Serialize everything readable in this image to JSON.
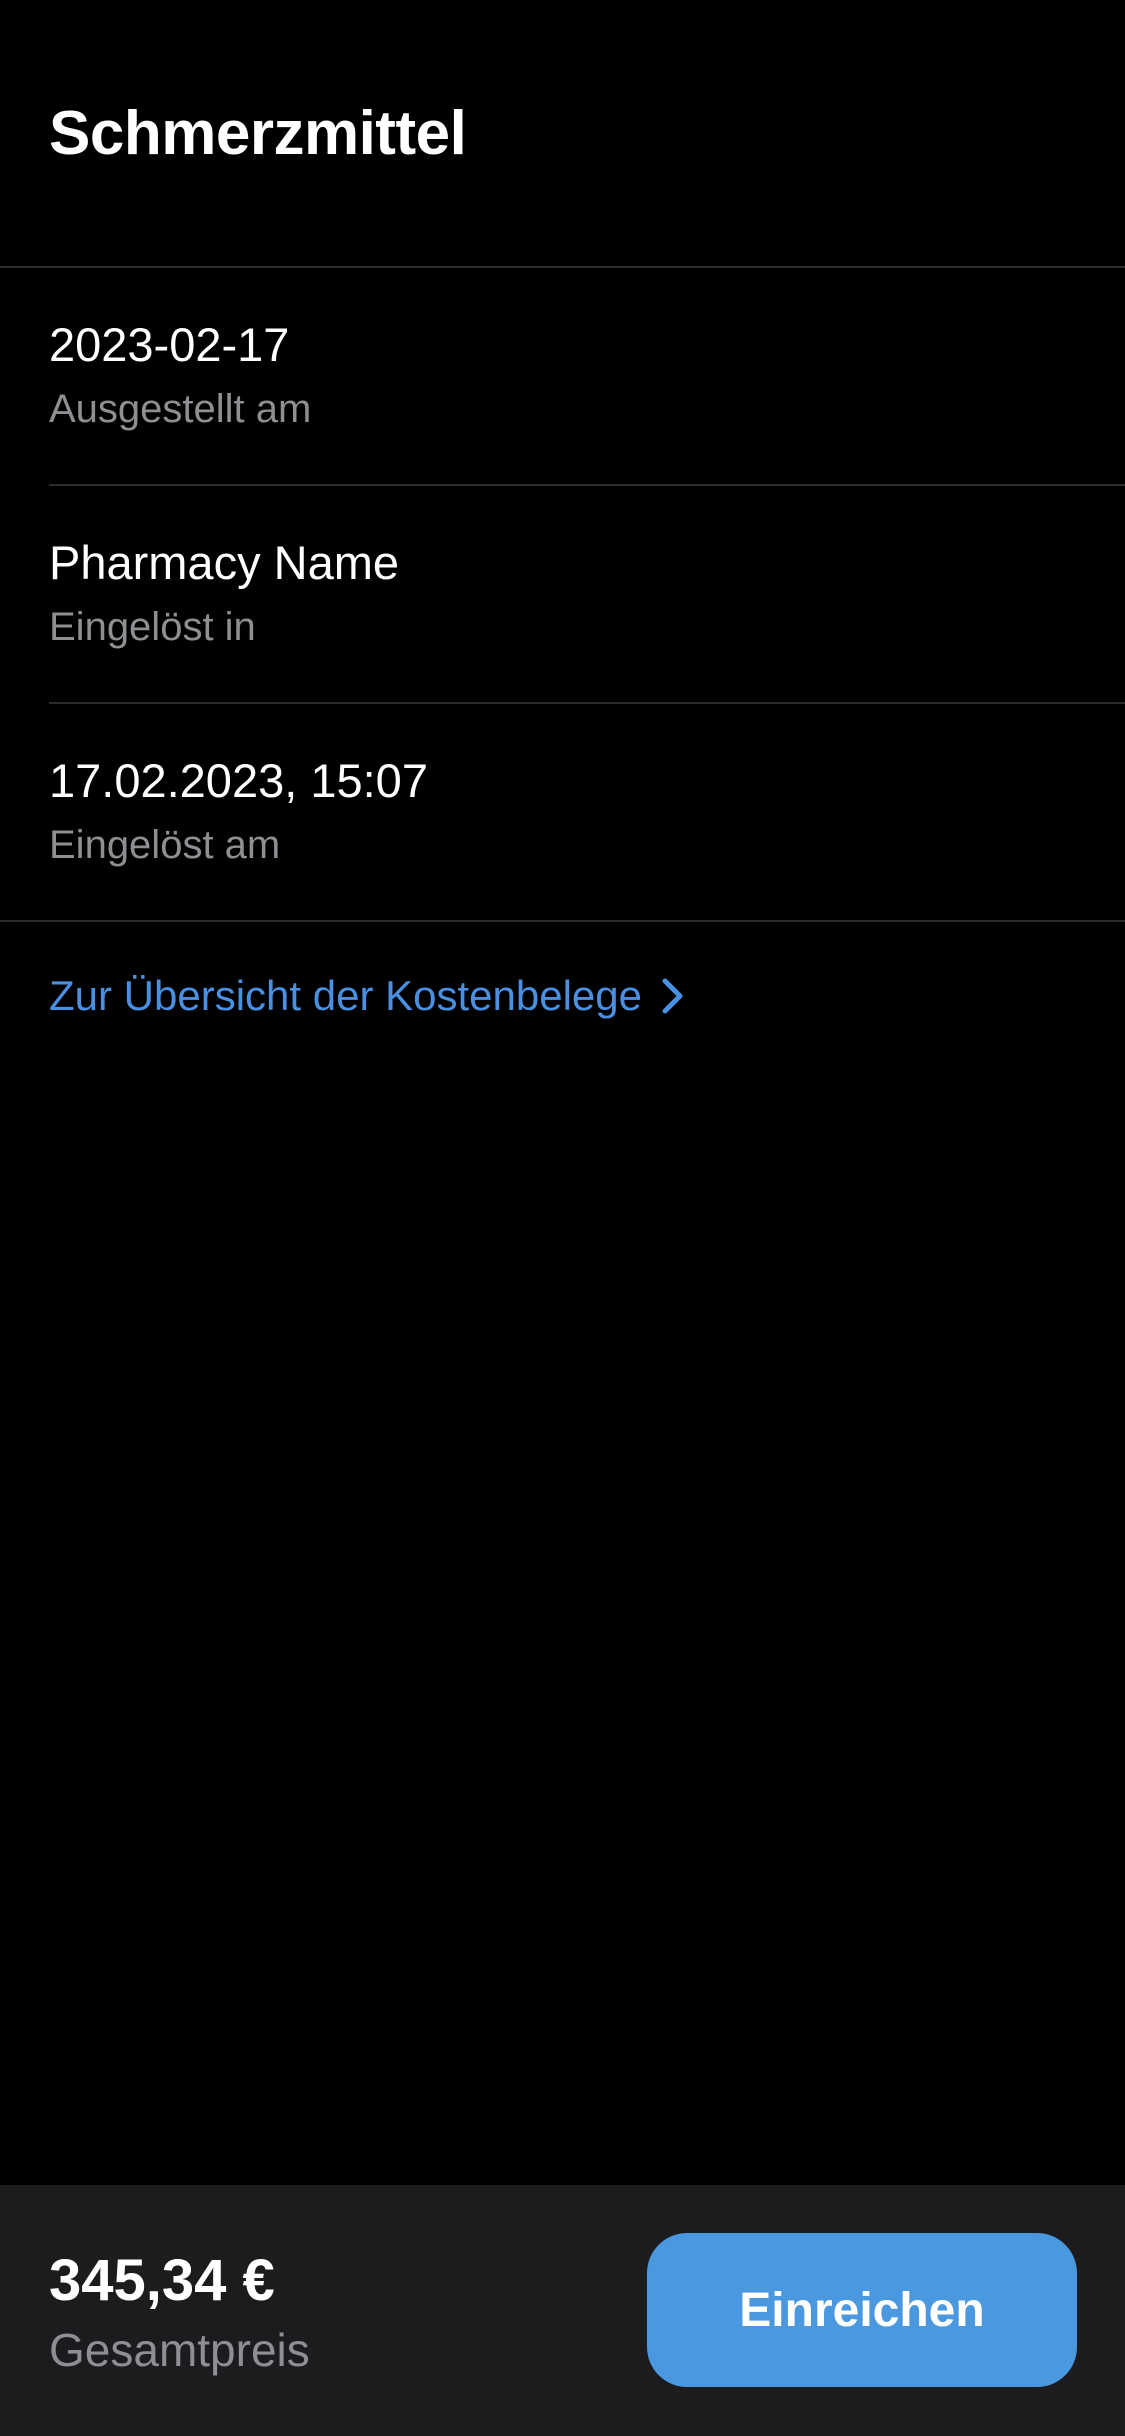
{
  "header": {
    "title": "Schmerzmittel"
  },
  "details": [
    {
      "value": "2023-02-17",
      "label": "Ausgestellt am"
    },
    {
      "value": "Pharmacy Name",
      "label": "Eingelöst in"
    },
    {
      "value": "17.02.2023, 15:07",
      "label": "Eingelöst am"
    }
  ],
  "link": {
    "label": "Zur Übersicht der Kostenbelege",
    "icon": "chevron-right-icon"
  },
  "footer": {
    "price": "345,34 €",
    "price_label": "Gesamtpreis",
    "submit_label": "Einreichen"
  },
  "colors": {
    "background": "#000000",
    "footer_background": "#1c1c1e",
    "accent": "#4a98e0",
    "secondary_text": "#8e8e93"
  }
}
